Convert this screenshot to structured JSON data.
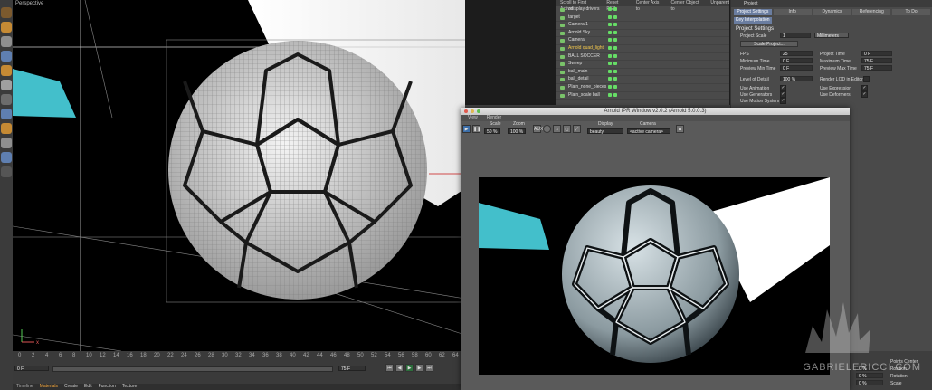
{
  "viewport": {
    "label": "Perspective"
  },
  "timeline": {
    "ticks": [
      "0",
      "2",
      "4",
      "6",
      "8",
      "10",
      "12",
      "14",
      "16",
      "18",
      "20",
      "22",
      "24",
      "26",
      "28",
      "30",
      "32",
      "34",
      "36",
      "38",
      "40",
      "42",
      "44",
      "46",
      "48",
      "50",
      "52",
      "54",
      "56",
      "58",
      "60",
      "62",
      "64"
    ],
    "start_frame": "0 F",
    "end_frame": "75 F"
  },
  "bottom_menu": {
    "tabs": [
      "Timeline",
      "Materials"
    ],
    "items": [
      "Create",
      "Edit",
      "Function",
      "Texture"
    ]
  },
  "object_manager": {
    "menu": [
      "Scroll to First Active",
      "Reset PSR",
      "Center Axis to",
      "Center Object to",
      "Unparent"
    ],
    "objects": [
      "cdisplay drivers",
      "target",
      "Camera.1",
      "Arnold Sky",
      "Camera",
      "Arnold quad_light",
      "BALL SOCCER",
      "Sweep",
      "ball_main",
      "ball_detail",
      "Plain_none_pieces",
      "Plain_scale ball"
    ],
    "selected_index": 5
  },
  "attributes": {
    "header": "Project",
    "tabs": [
      "Project Settings",
      "Info",
      "Dynamics",
      "Referencing",
      "To Do"
    ],
    "subtab": "Key Interpolation",
    "section": "Project Settings",
    "project_scale_label": "Project Scale",
    "project_scale_value": "1",
    "project_scale_unit": "Millimeters",
    "scale_button": "Scale Project...",
    "fields": {
      "fps": {
        "label": "FPS",
        "value": "25"
      },
      "min_time": {
        "label": "Minimum Time",
        "value": "0 F"
      },
      "preview_min": {
        "label": "Preview Min Time",
        "value": "0 F"
      },
      "lod": {
        "label": "Level of Detail",
        "value": "100 %"
      },
      "project_time": {
        "label": "Project Time",
        "value": "0 F"
      },
      "max_time": {
        "label": "Maximum Time",
        "value": "75 F"
      },
      "preview_max": {
        "label": "Preview Max Time",
        "value": "75 F"
      },
      "render_lod": {
        "label": "Render LOD in Editor"
      }
    },
    "checks": [
      "Use Animation",
      "Use Generators",
      "Use Motion System",
      "Use Expression",
      "Use Deformers"
    ],
    "bottom_rows": [
      "Points Center",
      "Position",
      "Rotation",
      "Scale"
    ],
    "bottom_values": [
      "0 %",
      "0 %",
      "0 %"
    ]
  },
  "ipr": {
    "title": "Arnold IPR Window v2.0.2 (Arnold 5.0.0.3)",
    "menu": [
      "View",
      "Render"
    ],
    "scale_label": "Scale",
    "scale_value": "50 %",
    "zoom_label": "Zoom",
    "zoom_value": "100 %",
    "aux_label": "AUX",
    "display_label": "Display",
    "display_value": "beauty",
    "camera_label": "Camera",
    "camera_value": "<active camera>"
  },
  "watermark": "GABRIELERICCI.COM",
  "colors": {
    "accent_blue": "#6a7da0",
    "selected_yellow": "#f2c649",
    "laser_cyan": "#4fe0ef"
  }
}
